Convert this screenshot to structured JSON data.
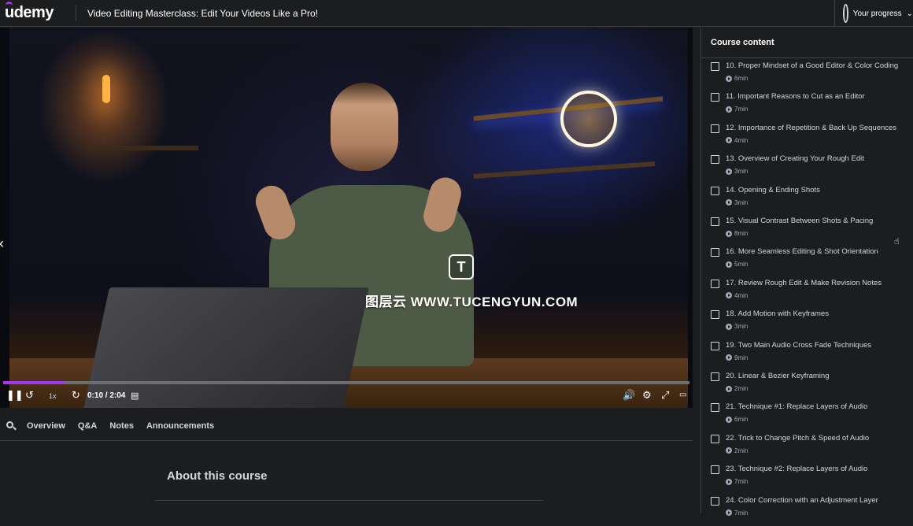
{
  "header": {
    "logo": "udemy",
    "course_title": "Video Editing Masterclass: Edit Your Videos Like a Pro!",
    "progress_label": "Your progress"
  },
  "player": {
    "time": "0:10 / 2:04",
    "playback_rate": "1x",
    "progress_fraction": 0.09,
    "watermark_text": "图层云 WWW.TUCENGYUN.COM",
    "watermark_badge": "T",
    "controls": [
      "pause-icon",
      "rewind-icon",
      "forward-icon",
      "notes-icon",
      "volume-icon",
      "settings-icon",
      "fullscreen-icon",
      "captions-icon"
    ]
  },
  "tabs": [
    "Overview",
    "Q&A",
    "Notes",
    "Announcements"
  ],
  "about": {
    "heading": "About this course"
  },
  "sidebar": {
    "title": "Course content",
    "lessons": [
      {
        "title": "10. Proper Mindset of a Good Editor & Color Coding",
        "duration": "6min"
      },
      {
        "title": "11. Important Reasons to Cut as an Editor",
        "duration": "7min"
      },
      {
        "title": "12. Importance of Repetition & Back Up Sequences",
        "duration": "4min"
      },
      {
        "title": "13. Overview of Creating Your Rough Edit",
        "duration": "3min"
      },
      {
        "title": "14. Opening & Ending Shots",
        "duration": "3min"
      },
      {
        "title": "15. Visual Contrast Between Shots & Pacing",
        "duration": "8min"
      },
      {
        "title": "16. More Seamless Editing & Shot Orientation",
        "duration": "5min"
      },
      {
        "title": "17. Review Rough Edit & Make Revision Notes",
        "duration": "4min"
      },
      {
        "title": "18. Add Motion with Keyframes",
        "duration": "3min"
      },
      {
        "title": "19. Two Main Audio Cross Fade Techniques",
        "duration": "9min"
      },
      {
        "title": "20. Linear & Bezier Keyframing",
        "duration": "2min"
      },
      {
        "title": "21. Technique #1: Replace Layers of Audio",
        "duration": "6min"
      },
      {
        "title": "22. Trick to Change Pitch & Speed of Audio",
        "duration": "2min"
      },
      {
        "title": "23. Technique #2: Replace Layers of Audio",
        "duration": "7min"
      },
      {
        "title": "24. Color Correction with an Adjustment Layer",
        "duration": "7min"
      }
    ]
  },
  "colors": {
    "accent": "#a435f0",
    "background": "#1c1d1f",
    "border": "#3e4143"
  }
}
